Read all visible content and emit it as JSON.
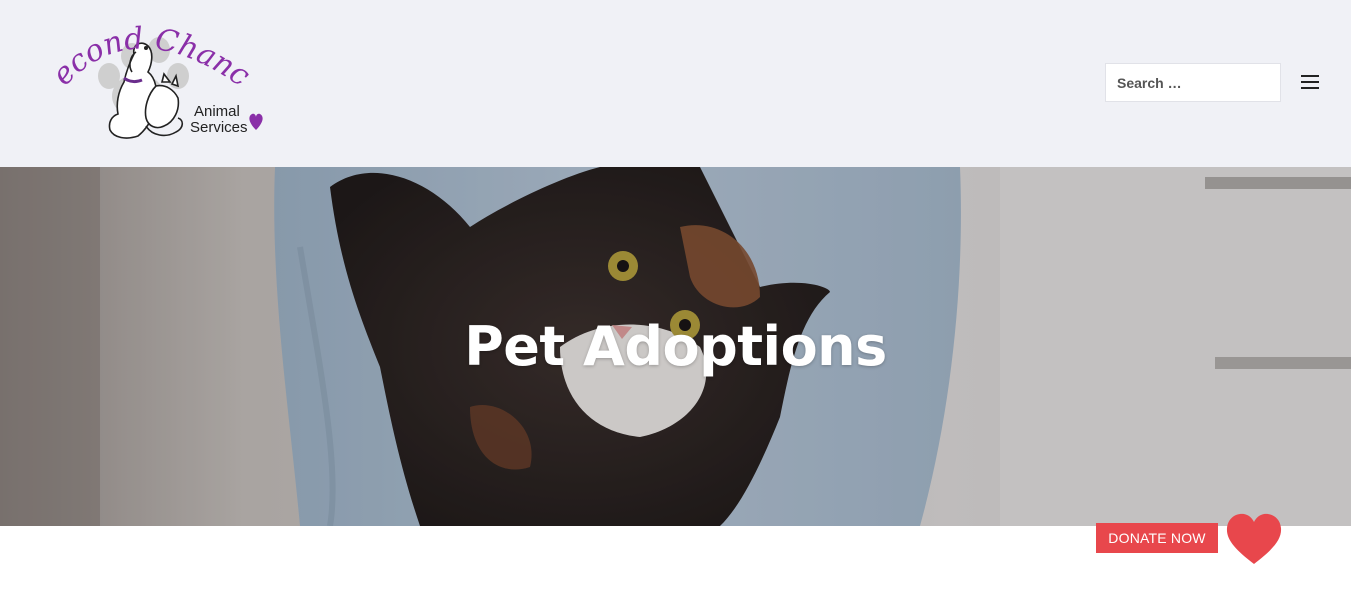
{
  "header": {
    "logo": {
      "script_text": "Second Chance",
      "line1": "Animal",
      "line2": "Services",
      "brand_color": "#8a2fa8"
    },
    "search": {
      "placeholder": "Search …"
    },
    "menu_icon": "hamburger-menu-icon"
  },
  "hero": {
    "title": "Pet Adoptions"
  },
  "donate": {
    "label": "DONATE NOW",
    "button_color": "#e8474c",
    "icon": "heart-icon"
  }
}
